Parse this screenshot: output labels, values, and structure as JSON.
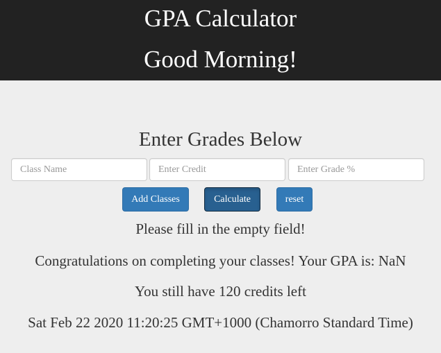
{
  "header": {
    "title": "GPA Calculator",
    "greeting": "Good Morning!"
  },
  "form": {
    "heading": "Enter Grades Below",
    "class_name": {
      "placeholder": "Class Name",
      "value": ""
    },
    "credit": {
      "placeholder": "Enter Credit",
      "value": ""
    },
    "grade": {
      "placeholder": "Enter Grade %",
      "value": ""
    }
  },
  "buttons": {
    "add_label": "Add Classes",
    "calculate_label": "Calculate",
    "reset_label": "reset"
  },
  "messages": {
    "error": "Please fill in the empty field!",
    "gpa": "Congratulations on completing your classes! Your GPA is: NaN",
    "credits_left": "You still have 120 credits left",
    "datetime": "Sat Feb 22 2020 11:20:25 GMT+1000 (Chamorro Standard Time)"
  },
  "colors": {
    "header_bg": "#222222",
    "page_bg": "#eeeeee",
    "button_primary": "#337ab7",
    "button_active": "#286090"
  }
}
